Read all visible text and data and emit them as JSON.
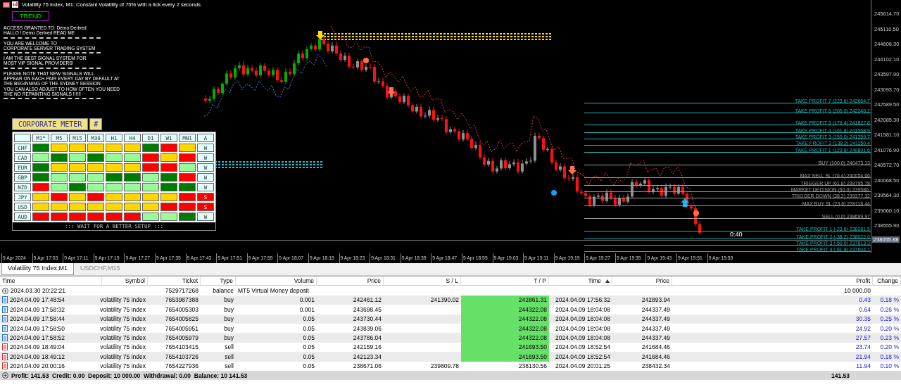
{
  "chart": {
    "title": "Volatility 75 Index, M1:  Constant Volatility of 75% with a tick every 2 seconds",
    "trend_label": "TREND",
    "message_groups": [
      [
        "ACCESS GRANTED TO: Demo Derived",
        "HALLO ! Demo Derived READ ME"
      ],
      [
        "YOU ARE WELCOME TO",
        "CORPORATE SERVER TRADING SYSTEM"
      ],
      [
        "I AM THE BEST SIGNAL SYSTEM FOR",
        "MOST VIP SIGNAL PROVIDERS!"
      ],
      [
        "PLEASE NOTE THAT NEW SIGNALS WILL",
        "APPEAR ON EACH PAIR EVERY DAY BY DEFAULT AT",
        "THE BEGINNING OF THE SYDNEY SESSION",
        "YOU CAN ALSO ADJUST TO HOW OFTEN YOU NEED",
        "THE NO REPAINTING SIGNALS !!!!!!"
      ]
    ],
    "meter": {
      "title": "CORPORATE METER",
      "hash": "#",
      "columns": [
        "M1*",
        "M5",
        "M15",
        "M30",
        "H1",
        "H4",
        "D1",
        "W1",
        "MN1",
        "A"
      ],
      "rows": [
        {
          "currency": "CHF",
          "cells": [
            {
              "color": "#007a00"
            },
            {
              "color": "#ffd700"
            },
            {
              "color": "#ffd700"
            },
            {
              "color": "#ffd700"
            },
            {
              "color": "#ffd700"
            },
            {
              "color": "#ffd700"
            },
            {
              "color": "#007a00"
            },
            {
              "color": "#ff0000"
            },
            {
              "color": "#ffd700"
            }
          ],
          "signal": {
            "text": "W",
            "color": "#e0ffff"
          }
        },
        {
          "currency": "CAD",
          "cells": [
            {
              "color": "#98fb98"
            },
            {
              "color": "#007a00"
            },
            {
              "color": "#98fb98"
            },
            {
              "color": "#007a00"
            },
            {
              "color": "#98fb98"
            },
            {
              "color": "#98fb98"
            },
            {
              "color": "#ff0000"
            },
            {
              "color": "#ffd700"
            },
            {
              "color": "#ff0000"
            }
          ],
          "signal": {
            "text": "W",
            "color": "#e0ffff"
          }
        },
        {
          "currency": "EUR",
          "cells": [
            {
              "color": "#007a00"
            },
            {
              "color": "#ffd700"
            },
            {
              "color": "#ffd700"
            },
            {
              "color": "#ffd700"
            },
            {
              "color": "#ffd700"
            },
            {
              "color": "#ffd700"
            },
            {
              "color": "#ff0000"
            },
            {
              "color": "#ff0000"
            },
            {
              "color": "#98fb98"
            }
          ],
          "signal": {
            "text": "W",
            "color": "#e0ffff"
          }
        },
        {
          "currency": "GBP",
          "cells": [
            {
              "color": "#007a00"
            },
            {
              "color": "#98fb98"
            },
            {
              "color": "#98fb98"
            },
            {
              "color": "#98fb98"
            },
            {
              "color": "#007a00"
            },
            {
              "color": "#007a00"
            },
            {
              "color": "#98fb98"
            },
            {
              "color": "#007a00"
            },
            {
              "color": "#ff0000"
            }
          ],
          "signal": {
            "text": "W",
            "color": "#e0ffff"
          }
        },
        {
          "currency": "NZD",
          "cells": [
            {
              "color": "#ff0000"
            },
            {
              "color": "#98fb98"
            },
            {
              "color": "#007a00"
            },
            {
              "color": "#98fb98"
            },
            {
              "color": "#98fb98"
            },
            {
              "color": "#98fb98"
            },
            {
              "color": "#98fb98"
            },
            {
              "color": "#007a00"
            },
            {
              "color": "#007a00"
            }
          ],
          "signal": {
            "text": "W",
            "color": "#e0ffff"
          }
        },
        {
          "currency": "JPY",
          "cells": [
            {
              "color": "#ffd700"
            },
            {
              "color": "#ff0000"
            },
            {
              "color": "#ffd700"
            },
            {
              "color": "#ff0000"
            },
            {
              "color": "#ffd700"
            },
            {
              "color": "#ffd700"
            },
            {
              "color": "#ffd700"
            },
            {
              "color": "#ffd700"
            },
            {
              "color": "#ff0000"
            }
          ],
          "signal": {
            "text": "S",
            "color": "#ff0000"
          }
        },
        {
          "currency": "USD",
          "cells": [
            {
              "color": "#ffd700"
            },
            {
              "color": "#ffd700"
            },
            {
              "color": "#ffd700"
            },
            {
              "color": "#ffd700"
            },
            {
              "color": "#ffd700"
            },
            {
              "color": "#ffd700"
            },
            {
              "color": "#ffd700"
            },
            {
              "color": "#ff0000"
            },
            {
              "color": "#ff0000"
            }
          ],
          "signal": {
            "text": "S",
            "color": "#ff0000"
          }
        },
        {
          "currency": "AUD",
          "cells": [
            {
              "color": "#ff0000"
            },
            {
              "color": "#ff0000"
            },
            {
              "color": "#ff0000"
            },
            {
              "color": "#ff0000"
            },
            {
              "color": "#ff0000"
            },
            {
              "color": "#ff0000"
            },
            {
              "color": "#98fb98"
            },
            {
              "color": "#98fb98"
            },
            {
              "color": "#007a00"
            }
          ],
          "signal": {
            "text": "W",
            "color": "#e0ffff"
          }
        }
      ],
      "status": "::: WAIT FOR A BETTER SETUP :::"
    },
    "levels": [
      {
        "label": "TAKE PROFIT 7  (223.6) 242664.7",
        "kind": "take_profit"
      },
      {
        "label": "TAKE PROFIT 6  (200.0) 242246.2",
        "kind": "take_profit"
      },
      {
        "label": "TAKE PROFIT 5  (176.4) 241827.8",
        "kind": "take_profit"
      },
      {
        "label": "TAKE PROFIT 4  (161.8) 241568.9",
        "kind": "take_profit"
      },
      {
        "label": "TAKE PROFIT 3  (150.0) 241359.7",
        "kind": "take_profit"
      },
      {
        "label": "TAKE PROFIT 2  (138.2) 241150.4",
        "kind": "take_profit"
      },
      {
        "label": "TAKE PROFIT 1  (123.6) 240891.6",
        "kind": "take_profit"
      },
      {
        "label": "BUY  (100.0) 240473.13",
        "kind": "level"
      },
      {
        "label": "MAX SELL SL  (76.4) 240054.66",
        "kind": "level"
      },
      {
        "label": "TRIGGER UP  (61.8) 239795.78",
        "kind": "level"
      },
      {
        "label": "MARKET DECISION  (50.0) 239586.",
        "kind": "level"
      },
      {
        "label": "TRIGGER DOWN  (38.2) 239377.32",
        "kind": "level"
      },
      {
        "label": "MAX BUY SL  (23.6) 239118.44",
        "kind": "level"
      },
      {
        "label": "SELL  (0.0) 238699.97",
        "kind": "level"
      },
      {
        "label": "TAKE PROFIT 1  (-23.6) 238281.5",
        "kind": "take_profit"
      },
      {
        "label": "TAKE PROFIT 2  (-38.2) 238022.6",
        "kind": "take_profit"
      },
      {
        "label": "TAKE PROFIT 3  (-50.0) 237813.3",
        "kind": "take_profit"
      },
      {
        "label": "TAKE PROFIT 4  (-61.8) 237604.1",
        "kind": "take_profit"
      }
    ],
    "countdown": "0:40",
    "price_axis": [
      "245614.70",
      "245110.50",
      "244606.30",
      "244102.10",
      "243597.90",
      "243093.70",
      "242589.50",
      "242085.30",
      "241581.10",
      "241076.90",
      "240572.70",
      "240068.50",
      "239564.30",
      "239060.10",
      "238555.90"
    ],
    "current_price": "238055.88",
    "time_axis": [
      "9 Apr 2024",
      "9 Apr 17:03",
      "9 Apr 17:11",
      "9 Apr 17:19",
      "9 Apr 17:27",
      "9 Apr 17:35",
      "9 Apr 17:43",
      "9 Apr 17:51",
      "9 Apr 17:59",
      "9 Apr 18:07",
      "9 Apr 18:15",
      "9 Apr 18:23",
      "9 Apr 18:31",
      "9 Apr 18:39",
      "9 Apr 18:47",
      "9 Apr 18:55",
      "9 Apr 19:03",
      "9 Apr 19:11",
      "9 Apr 19:19",
      "9 Apr 19:27",
      "9 Apr 19:35",
      "9 Apr 19:43",
      "9 Apr 19:51",
      "9 Apr 19:59"
    ]
  },
  "tabs": [
    {
      "label": "Volatility 75 Index,M1",
      "selected": true
    },
    {
      "label": "USDCHF,M15",
      "selected": false
    }
  ],
  "table": {
    "columns": [
      {
        "label": "Time",
        "sorted": false
      },
      {
        "label": "Symbol",
        "sorted": false
      },
      {
        "label": "Ticket",
        "sorted": false
      },
      {
        "label": "Type",
        "sorted": false
      },
      {
        "label": "Volume",
        "sorted": false
      },
      {
        "label": "Price",
        "sorted": false
      },
      {
        "label": "S / L",
        "sorted": false
      },
      {
        "label": "T / P",
        "sorted": false
      },
      {
        "label": "Time",
        "sorted": true
      },
      {
        "label": "Price",
        "sorted": false
      },
      {
        "label": "Profit",
        "sorted": false
      },
      {
        "label": "Change",
        "sorted": false
      }
    ],
    "rows": [
      {
        "kind": "balance",
        "time": "2024.03.30 20:22:21",
        "ticket": "7529717268",
        "type": "balance",
        "comment": "MT5 Virtual Money deposit",
        "profit": "10 000.00"
      },
      {
        "kind": "buy",
        "time": "2024.04.09 17:48:54",
        "symbol": "volatility 75 index",
        "ticket": "7653987388",
        "type": "buy",
        "volume": "0.001",
        "price": "242461.12",
        "sl": "241390.02",
        "tp": "242861.31",
        "tp_hit": true,
        "close_time": "2024.04.09 17:56:32",
        "close_price": "242893.94",
        "profit": "0.43",
        "change": "0.18 %"
      },
      {
        "kind": "buy",
        "time": "2024.04.09 17:58:32",
        "symbol": "volatility 75 index",
        "ticket": "7654005303",
        "type": "buy",
        "volume": "0.001",
        "price": "243698.45",
        "tp": "244322.08",
        "tp_hit": true,
        "close_time": "2024.04.09 18:04:08",
        "close_price": "244337.49",
        "profit": "0.64",
        "change": "0.26 %"
      },
      {
        "kind": "buy",
        "time": "2024.04.09 17:58:44",
        "symbol": "volatility 75 index",
        "ticket": "7654005825",
        "type": "buy",
        "volume": "0.05",
        "price": "243730.44",
        "tp": "244322.08",
        "tp_hit": true,
        "close_time": "2024.04.09 18:04:08",
        "close_price": "244337.49",
        "profit": "30.35",
        "change": "0.25 %"
      },
      {
        "kind": "buy",
        "time": "2024.04.09 17:58:50",
        "symbol": "volatility 75 index",
        "ticket": "7654005951",
        "type": "buy",
        "volume": "0.05",
        "price": "243839.06",
        "tp": "244322.08",
        "tp_hit": true,
        "close_time": "2024.04.09 18:04:08",
        "close_price": "244337.49",
        "profit": "24.92",
        "change": "0.20 %"
      },
      {
        "kind": "buy",
        "time": "2024.04.09 17:58:52",
        "symbol": "volatility 75 index",
        "ticket": "7654005979",
        "type": "buy",
        "volume": "0.05",
        "price": "243786.04",
        "tp": "244322.08",
        "tp_hit": true,
        "close_time": "2024.04.09 18:04:08",
        "close_price": "244337.49",
        "profit": "27.57",
        "change": "0.23 %"
      },
      {
        "kind": "sell",
        "time": "2024.04.09 18:49:04",
        "symbol": "volatility 75 index",
        "ticket": "7654103415",
        "type": "sell",
        "volume": "0.05",
        "price": "242159.16",
        "tp": "241693.50",
        "tp_hit": true,
        "close_time": "2024.04.09 18:52:54",
        "close_price": "241684.46",
        "profit": "23.74",
        "change": "0.20 %"
      },
      {
        "kind": "sell",
        "time": "2024.04.09 18:49:12",
        "symbol": "volatility 75 index",
        "ticket": "7654103726",
        "type": "sell",
        "volume": "0.05",
        "price": "242123.34",
        "tp": "241693.50",
        "tp_hit": true,
        "close_time": "2024.04.09 18:52:54",
        "close_price": "241684.46",
        "profit": "21.94",
        "change": "0.18 %"
      },
      {
        "kind": "sell",
        "time": "2024.04.09 20:00:16",
        "symbol": "volatility 75 index",
        "ticket": "7654227936",
        "type": "sell",
        "volume": "0.05",
        "price": "238671.06",
        "sl": "239809.78",
        "tp": "238130.56",
        "tp_hit": false,
        "close_time": "2024.04.09 20:01:25",
        "close_price": "238432.34",
        "profit": "11.94",
        "change": "0.10 %"
      }
    ],
    "summary": {
      "text": "Profit: 141.53  Credit: 0.00  Deposit: 10 000.00  Withdrawal: 0.00  Balance: 10 141.53",
      "total": "141.53"
    }
  }
}
